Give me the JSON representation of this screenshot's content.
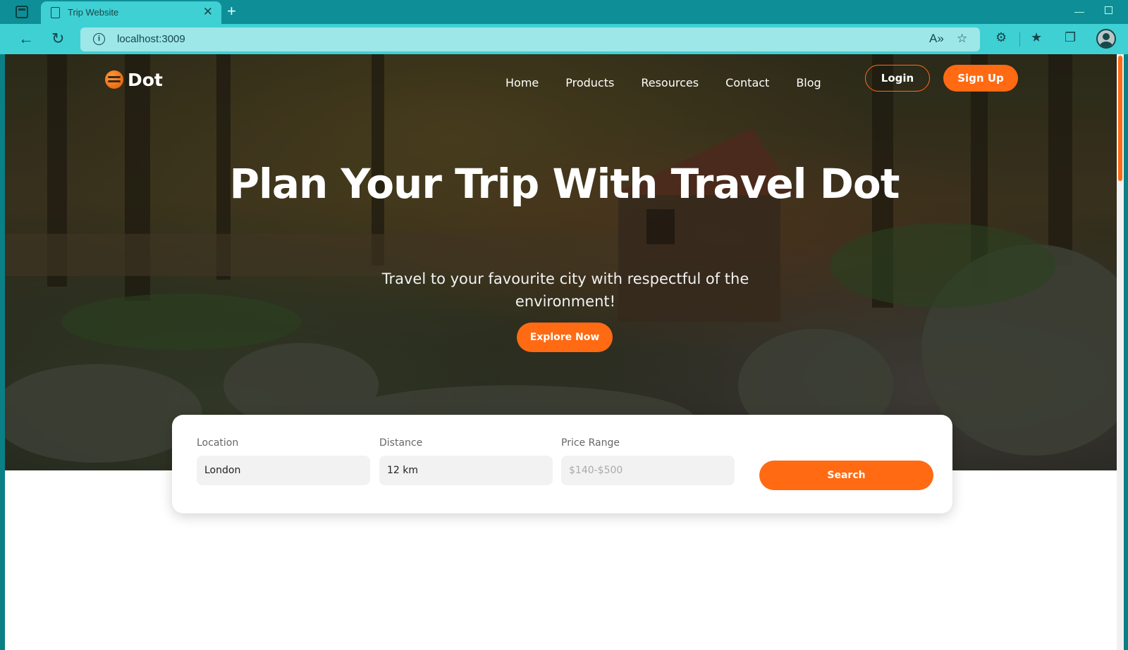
{
  "browser": {
    "tab_title": "Trip Website",
    "tab_close": "✕",
    "new_tab": "+",
    "url": "localhost:3009",
    "read_aloud": "A»"
  },
  "site": {
    "logo_text": "Dot",
    "nav": [
      "Home",
      "Products",
      "Resources",
      "Contact",
      "Blog"
    ],
    "login_label": "Login",
    "signup_label": "Sign Up"
  },
  "hero": {
    "title": "Plan Your Trip With Travel Dot",
    "subtitle": "Travel to your favourite city with respectful of the environment!",
    "cta_label": "Explore Now"
  },
  "search": {
    "location_label": "Location",
    "location_value": "London",
    "distance_label": "Distance",
    "distance_value": "12 km",
    "price_label": "Price Range",
    "price_placeholder": "$140-$500",
    "search_label": "Search"
  },
  "colors": {
    "accent": "#ff6a13",
    "browser_chrome": "#3fd0d4"
  }
}
